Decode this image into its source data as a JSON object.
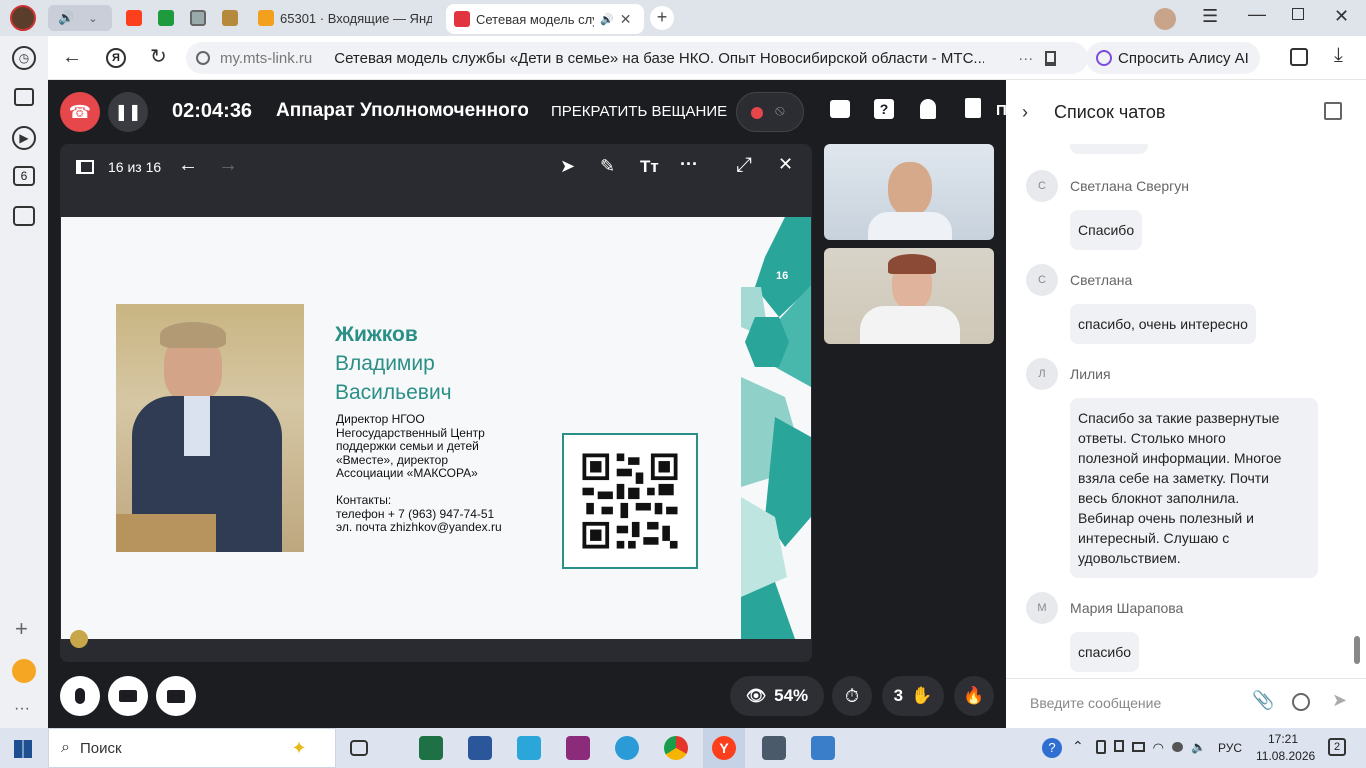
{
  "browser": {
    "tabs": [
      {
        "label": "65301 · Входящие — Янде",
        "color": "#f2a01e"
      },
      {
        "label": "Сетевая модель слу",
        "color": "#e2343f",
        "active": true
      }
    ],
    "address": {
      "domain": "my.mts-link.ru",
      "page_title": "Сетевая модель службы «Дети в семье» на базе НКО. Опыт Новосибирской области - МТС..."
    },
    "alisa_label": "Спросить Алису AI",
    "rail_badge": "6"
  },
  "webinar": {
    "timer": "02:04:36",
    "event_title": "Аппарат Уполномоченного",
    "stop_label": "ПРЕКРАТИТЬ ВЕЩАНИЕ",
    "slide_counter": "16 из 16",
    "viewers_percent": "54%",
    "raised_hands": "3",
    "slide": {
      "page_number": "16",
      "name_bold": "Жижков",
      "name_line2": "Владимир",
      "name_line3": "Васильевич",
      "desc": [
        "Директор  НГОО",
        "Негосударственный Центр",
        "поддержки семьи и детей",
        "«Вместе», директор",
        "Ассоциации «МАКСОРА»"
      ],
      "contacts_title": "Контакты:",
      "phone": "телефон + 7 (963) 947-74-51",
      "email": "эл. почта zhizhkov@yandex.ru"
    }
  },
  "chat": {
    "header": "Список чатов",
    "input_placeholder": "Введите сообщение",
    "messages": [
      {
        "initial": "С",
        "author": "Светлана Свергун",
        "lines": [
          "Спасибо"
        ]
      },
      {
        "initial": "С",
        "author": "Светлана",
        "lines": [
          "спасибо, очень интересно"
        ]
      },
      {
        "initial": "Л",
        "author": "Лилия",
        "lines": [
          "Спасибо  за такие  развернутые",
          "ответы.  Столько много",
          "полезной информации. Многое",
          "взяла себе на заметку. Почти",
          "весь   блокнот заполнила.",
          "Вебинар очень полезный  и",
          "интересный. Слушаю с",
          "удовольствием."
        ]
      },
      {
        "initial": "М",
        "author": "Мария Шарапова",
        "lines": [
          "спасибо"
        ]
      }
    ]
  },
  "taskbar": {
    "search_label": "Поиск",
    "lang": "РУС",
    "time": "17:21",
    "date": "11.08.2026",
    "notif_count": "2"
  }
}
